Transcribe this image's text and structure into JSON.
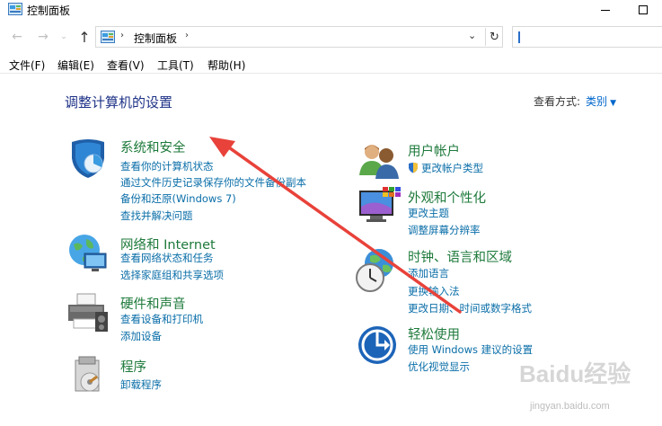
{
  "window": {
    "title": "控制面板"
  },
  "address": {
    "crumb": "控制面板",
    "sep": "›"
  },
  "menu": {
    "items": [
      "文件(F)",
      "编辑(E)",
      "查看(V)",
      "工具(T)",
      "帮助(H)"
    ]
  },
  "main": {
    "heading": "调整计算机的设置",
    "view_label": "查看方式:",
    "view_value": "类别"
  },
  "categories": {
    "system": {
      "title": "系统和安全",
      "links": [
        "查看你的计算机状态",
        "通过文件历史记录保存你的文件备份副本",
        "备份和还原(Windows 7)",
        "查找并解决问题"
      ]
    },
    "network": {
      "title": "网络和 Internet",
      "links": [
        "查看网络状态和任务",
        "选择家庭组和共享选项"
      ]
    },
    "hardware": {
      "title": "硬件和声音",
      "links": [
        "查看设备和打印机",
        "添加设备"
      ]
    },
    "programs": {
      "title": "程序",
      "links": [
        "卸载程序"
      ]
    },
    "users": {
      "title": "用户帐户",
      "links": [
        "更改帐户类型"
      ]
    },
    "appearance": {
      "title": "外观和个性化",
      "links": [
        "更改主题",
        "调整屏幕分辨率"
      ]
    },
    "clock": {
      "title": "时钟、语言和区域",
      "links": [
        "添加语言",
        "更换输入法",
        "更改日期、时间或数字格式"
      ]
    },
    "ease": {
      "title": "轻松使用",
      "links": [
        "使用 Windows 建议的设置",
        "优化视觉显示"
      ]
    }
  },
  "watermark": {
    "text": "Baidu经验",
    "url": "jingyan.baidu.com"
  },
  "colors": {
    "heading": "#1e3287",
    "category_title": "#1e7a3b",
    "link": "#0a6ea8",
    "annotation_arrow": "#e8423a"
  }
}
